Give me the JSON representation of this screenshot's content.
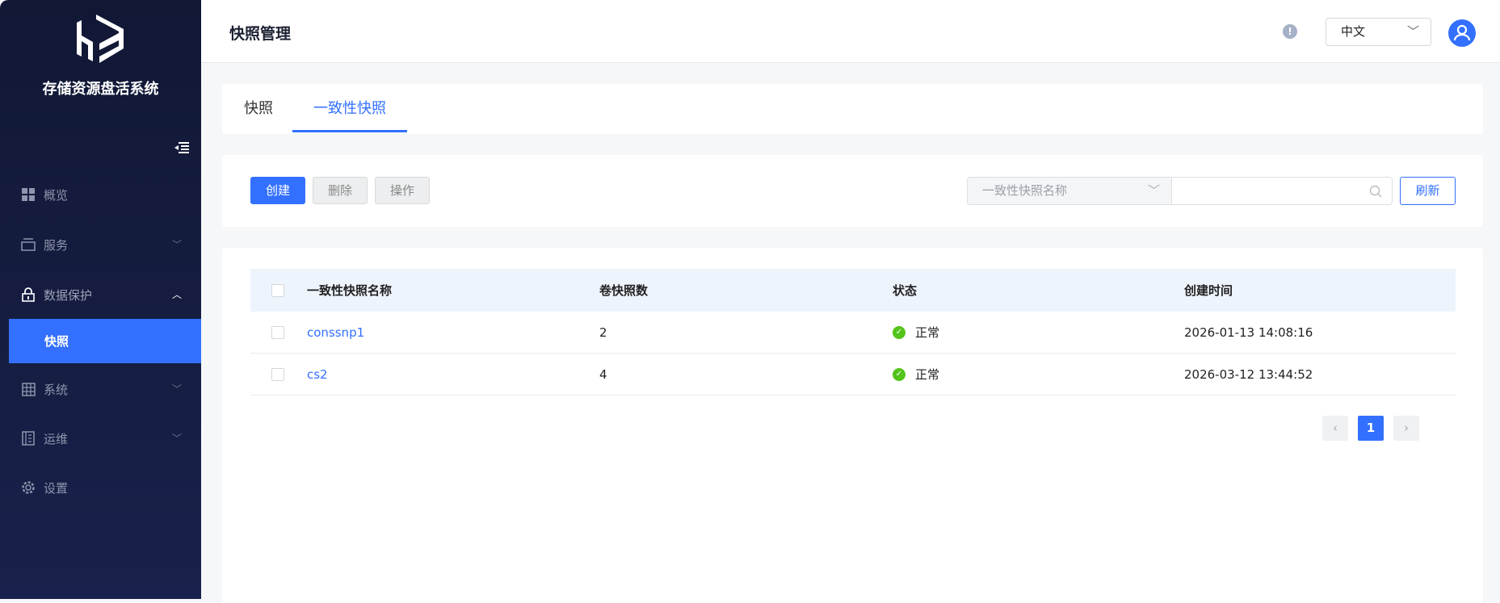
{
  "app": {
    "brand": "存储资源盘活系统",
    "logo_text": "HB"
  },
  "sidebar": {
    "items": [
      {
        "label": "概览",
        "icon": "grid-icon"
      },
      {
        "label": "服务",
        "icon": "layers-icon"
      },
      {
        "label": "数据保护",
        "icon": "lock-icon"
      },
      {
        "label": "系统",
        "icon": "table-icon"
      },
      {
        "label": "运维",
        "icon": "notebook-icon"
      },
      {
        "label": "设置",
        "icon": "gear-icon"
      }
    ],
    "active_sub": "快照"
  },
  "header": {
    "title": "快照管理",
    "language": "中文",
    "info_glyph": "!"
  },
  "tabs": [
    {
      "label": "快照"
    },
    {
      "label": "一致性快照",
      "active": true
    }
  ],
  "toolbar": {
    "create": "创建",
    "delete": "删除",
    "operate": "操作",
    "filter_field": "一致性快照名称",
    "search_value": "",
    "refresh": "刷新"
  },
  "table": {
    "columns": [
      "一致性快照名称",
      "卷快照数",
      "状态",
      "创建时间"
    ],
    "rows": [
      {
        "name": "conssnp1",
        "count": "2",
        "status": "正常",
        "created": "2026-01-13 14:08:16"
      },
      {
        "name": "cs2",
        "count": "4",
        "status": "正常",
        "created": "2026-03-12 13:44:52"
      }
    ]
  },
  "pagination": {
    "current": "1",
    "prev": "‹",
    "next": "›"
  },
  "colors": {
    "accent": "#3370ff",
    "sidebar": "#111834",
    "success": "#52c41a"
  }
}
